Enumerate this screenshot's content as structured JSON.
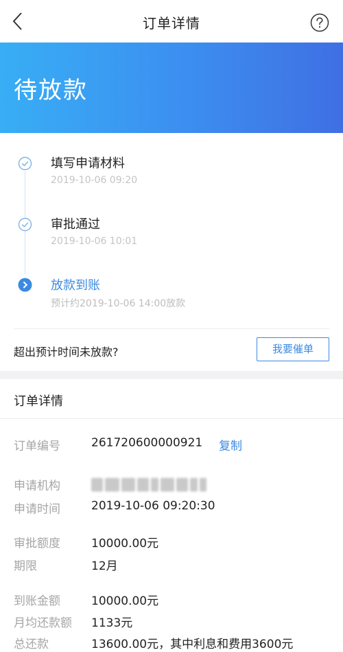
{
  "navbar": {
    "title": "订单详情",
    "back_icon": "chevron-left-icon",
    "help_icon": "question-circle-icon"
  },
  "banner": {
    "status": "待放款",
    "gradient_colors": [
      "#38aef5",
      "#3f6fe3"
    ]
  },
  "timeline": {
    "steps": [
      {
        "title": "填写申请材料",
        "time": "2019-10-06 09:20",
        "state": "done"
      },
      {
        "title": "审批通过",
        "time": "2019-10-06 10:01",
        "state": "done"
      },
      {
        "title": "放款到账",
        "time": "预计约2019-10-06 14:00放款",
        "state": "active"
      }
    ]
  },
  "urge": {
    "text": "超出预计时间未放款?",
    "button_label": "我要催单"
  },
  "order_detail": {
    "header": "订单详情",
    "order_no_label": "订单编号",
    "order_no": "261720600000921",
    "copy_label": "复制",
    "institution_label": "申请机构",
    "apply_time_label": "申请时间",
    "apply_time": "2019-10-06 09:20:30",
    "approved_amount_label": "审批额度",
    "approved_amount": "10000.00元",
    "term_label": "期限",
    "term": "12月",
    "received_amount_label": "到账金额",
    "received_amount": "10000.00元",
    "monthly_repay_label": "月均还款额",
    "monthly_repay": "1133元",
    "total_repay_label": "总还款",
    "total_repay": "13600.00元，其中利息和费用3600元"
  },
  "colors": {
    "accent": "#3b8ae0",
    "label_gray": "#a5a5a5",
    "time_gray": "#c4c4c4"
  }
}
